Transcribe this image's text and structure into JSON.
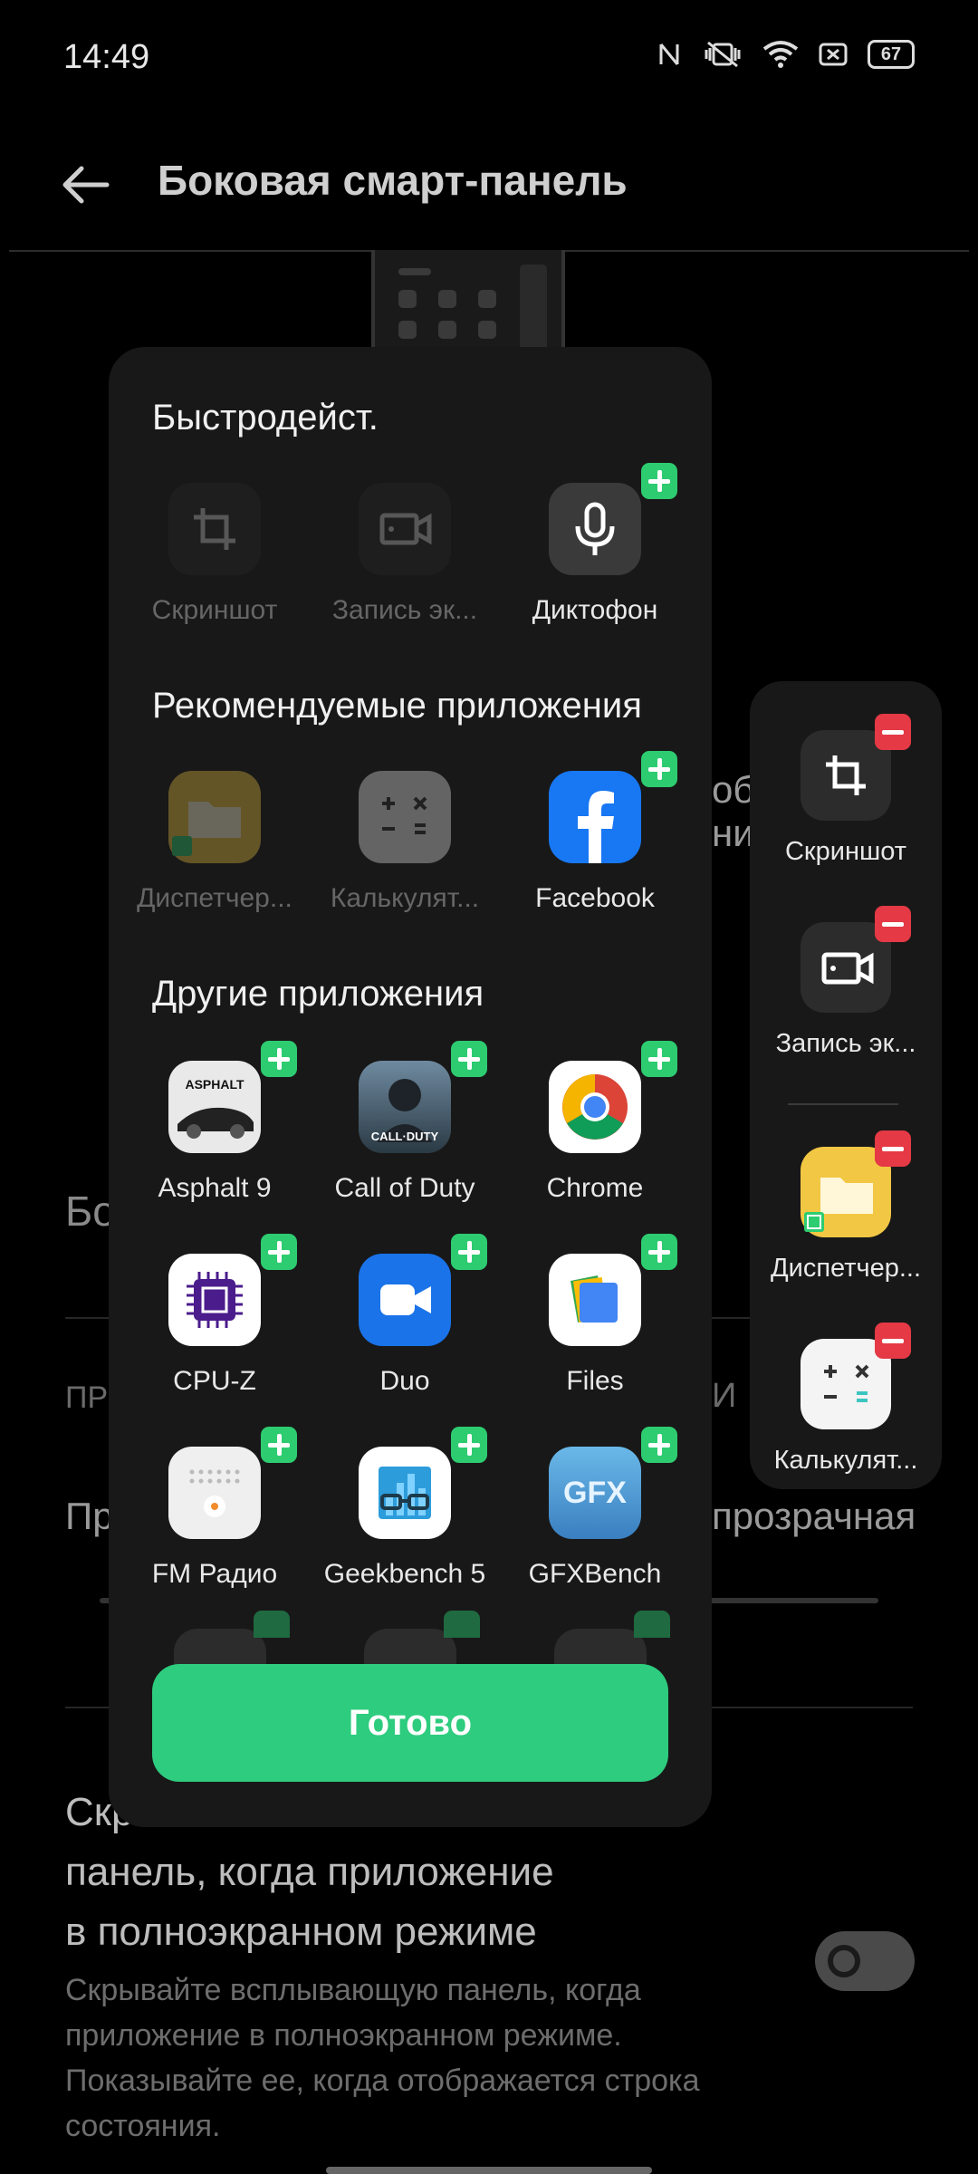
{
  "status": {
    "time": "14:49",
    "battery": "67"
  },
  "header": {
    "title": "Боковая смарт-панель"
  },
  "background": {
    "partial_text_1": "оба",
    "partial_text_2": "ния",
    "section_label": "Бо",
    "caps_left": "ПР",
    "caps_right": "И",
    "option_left": "Пр",
    "option_right": "прозрачная",
    "big_title_line1": "Скр",
    "big_title_line2": "панель, когда приложение",
    "big_title_line3": "в полноэкранном режиме",
    "description": "Скрывайте всплывающую панель, когда приложение в полноэкранном режиме. Показывайте ее, когда отображается строка состояния."
  },
  "picker": {
    "quick_title": "Быстродейст.",
    "quick": [
      {
        "label": "Скриншот",
        "icon": "crop-icon"
      },
      {
        "label": "Запись эк...",
        "icon": "screen-record-icon"
      },
      {
        "label": "Диктофон",
        "icon": "microphone-icon"
      }
    ],
    "recommended_title": "Рекомендуемые приложения",
    "recommended": [
      {
        "label": "Диспетчер...",
        "icon": "file-manager-icon"
      },
      {
        "label": "Калькулят...",
        "icon": "calculator-icon"
      },
      {
        "label": "Facebook",
        "icon": "facebook-icon"
      }
    ],
    "other_title": "Другие приложения",
    "other": [
      {
        "label": "Asphalt 9",
        "icon": "asphalt-icon",
        "icon_text": "ASPHALT"
      },
      {
        "label": "Call of Duty",
        "icon": "call-of-duty-icon",
        "icon_text": "CALL·DUTY"
      },
      {
        "label": "Chrome",
        "icon": "chrome-icon"
      },
      {
        "label": "CPU-Z",
        "icon": "cpu-z-icon"
      },
      {
        "label": "Duo",
        "icon": "duo-icon"
      },
      {
        "label": "Files",
        "icon": "files-icon"
      },
      {
        "label": "FM Радио",
        "icon": "fm-radio-icon"
      },
      {
        "label": "Geekbench 5",
        "icon": "geekbench-icon"
      },
      {
        "label": "GFXBench",
        "icon": "gfxbench-icon",
        "icon_text": "GFX"
      }
    ],
    "done_label": "Готово"
  },
  "sidebar": {
    "items": [
      {
        "label": "Скриншот",
        "icon": "crop-icon"
      },
      {
        "label": "Запись эк...",
        "icon": "screen-record-icon"
      },
      {
        "label": "Диспетчер...",
        "icon": "file-manager-icon"
      },
      {
        "label": "Калькулят...",
        "icon": "calculator-icon"
      }
    ]
  },
  "colors": {
    "accent": "#2ecc7e",
    "add": "#2ecc71",
    "remove": "#e53945",
    "panel": "#181818"
  }
}
